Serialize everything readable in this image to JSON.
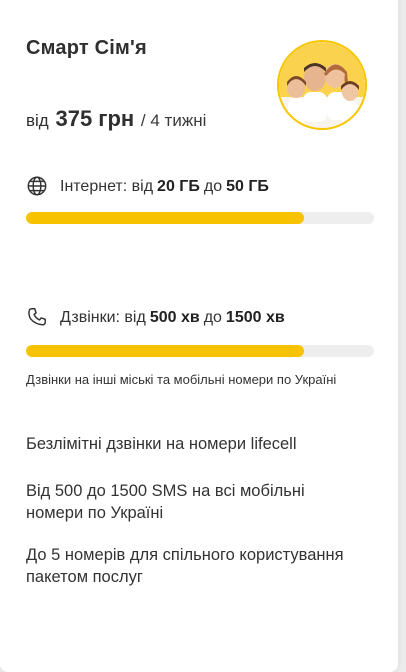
{
  "plan": {
    "title": "Смарт Сім'я",
    "price_prefix": "від",
    "price_amount": "375 грн",
    "price_period": "/ 4 тижні",
    "avatar_icon": "family-photo"
  },
  "internet": {
    "icon": "globe-icon",
    "label": "Інтернет: від",
    "min": "20 ГБ",
    "sep": "до",
    "max": "50 ГБ",
    "progress_fraction": 0.8,
    "bar_color": "#f7c300"
  },
  "calls": {
    "icon": "phone-icon",
    "label": "Дзвінки: від",
    "min": "500 хв",
    "sep": "до",
    "max": "1500 хв",
    "progress_fraction": 0.8,
    "note": "Дзвінки на інші міські та мобільні номери по Україні"
  },
  "features": [
    "Безлімітні дзвінки на номери lifecell",
    "Від 500 до 1500 SMS на всі мобільні номери по Україні",
    "До 5 номерів для спільного користування пакетом послуг"
  ]
}
